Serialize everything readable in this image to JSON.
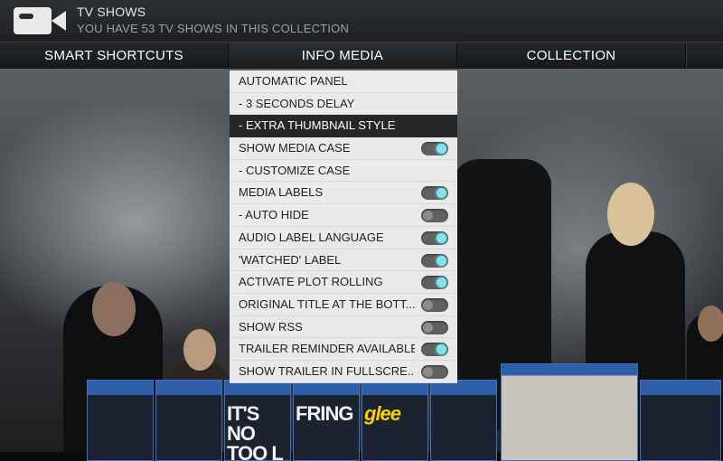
{
  "header": {
    "title": "TV SHOWS",
    "subtitle": "YOU HAVE 53 TV SHOWS IN THIS COLLECTION",
    "icon": "video-camera-icon"
  },
  "tabs": [
    {
      "label": "SMART SHORTCUTS"
    },
    {
      "label": "INFO MEDIA",
      "active": true
    },
    {
      "label": "COLLECTION"
    }
  ],
  "menu": {
    "items": [
      {
        "label": "AUTOMATIC PANEL"
      },
      {
        "label": "- 3 SECONDS DELAY"
      },
      {
        "label": "- EXTRA THUMBNAIL STYLE",
        "selected": true
      },
      {
        "label": "SHOW MEDIA CASE",
        "toggle": "on"
      },
      {
        "label": "- CUSTOMIZE CASE"
      },
      {
        "label": "MEDIA LABELS",
        "toggle": "on"
      },
      {
        "label": "- AUTO HIDE",
        "toggle": "off"
      },
      {
        "label": "AUDIO LABEL LANGUAGE",
        "toggle": "on"
      },
      {
        "label": "'WATCHED' LABEL",
        "toggle": "on"
      },
      {
        "label": "ACTIVATE PLOT ROLLING",
        "toggle": "on"
      },
      {
        "label": "ORIGINAL TITLE AT THE BOTT...",
        "toggle": "off"
      },
      {
        "label": "SHOW RSS",
        "toggle": "off"
      },
      {
        "label": "TRAILER REMINDER AVAILABLE",
        "toggle": "on"
      },
      {
        "label": "SHOW TRAILER IN FULLSCRE...",
        "toggle": "off"
      }
    ]
  },
  "covers": [
    {
      "title": ""
    },
    {
      "title": ""
    },
    {
      "title": "IT'S NO TOO L"
    },
    {
      "title": "FRING"
    },
    {
      "title": "glee"
    },
    {
      "title": ""
    },
    {
      "title": ""
    },
    {
      "title": ""
    }
  ],
  "colors": {
    "accent": "#7fe6f0",
    "selected_bg": "#262729",
    "panel_bg": "#f0f0f0"
  }
}
